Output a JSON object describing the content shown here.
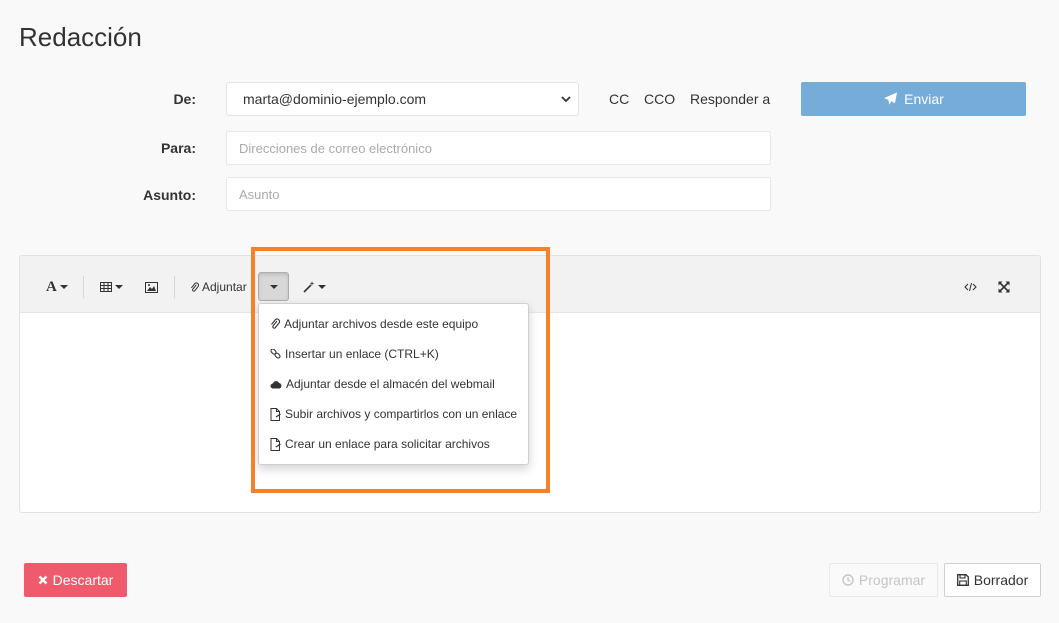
{
  "page": {
    "title": "Redacción"
  },
  "form": {
    "from_label": "De:",
    "from_value": "marta@dominio-ejemplo.com",
    "to_label": "Para:",
    "to_placeholder": "Direcciones de correo electrónico",
    "subject_label": "Asunto:",
    "subject_placeholder": "Asunto",
    "cc_label": "CC",
    "bcc_label": "CCO",
    "reply_to_label": "Responder a",
    "send_label": "Enviar"
  },
  "toolbar": {
    "font_icon": "font-icon",
    "table_icon": "table-icon",
    "image_icon": "image-icon",
    "attach_label": "Adjuntar",
    "magic_icon": "magic-wand-icon",
    "code_icon": "code-view-icon",
    "fullscreen_icon": "fullscreen-icon"
  },
  "attach_menu": {
    "items": [
      {
        "icon": "paperclip-icon",
        "label": "Adjuntar archivos desde este equipo"
      },
      {
        "icon": "link-icon",
        "label": "Insertar un enlace (CTRL+K)"
      },
      {
        "icon": "cloud-icon",
        "label": "Adjuntar desde el almacén del webmail"
      },
      {
        "icon": "file-share-icon",
        "label": "Subir archivos y compartirlos con un enlace"
      },
      {
        "icon": "file-request-icon",
        "label": "Crear un enlace para solicitar archivos"
      }
    ]
  },
  "footer": {
    "discard_label": "Descartar",
    "schedule_label": "Programar",
    "draft_label": "Borrador"
  },
  "colors": {
    "send_button": "#76acd8",
    "discard_button": "#ef5a6c",
    "highlight_border": "#f5812b"
  }
}
